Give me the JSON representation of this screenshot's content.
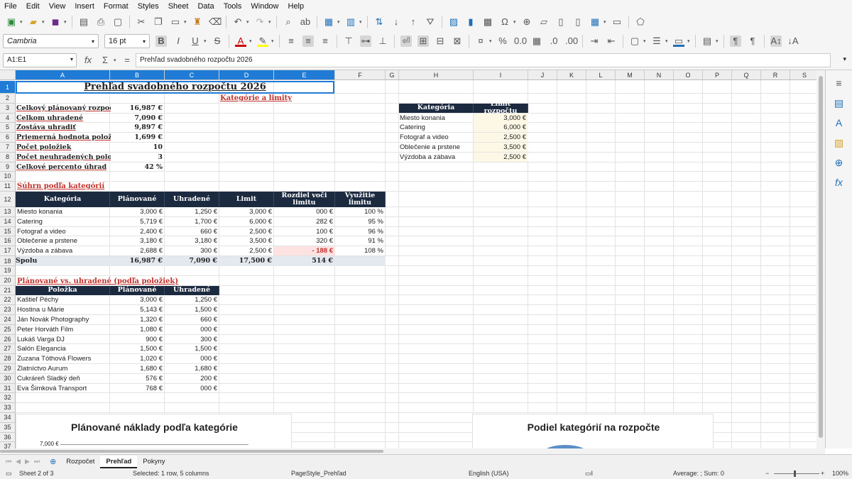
{
  "menu": [
    "File",
    "Edit",
    "View",
    "Insert",
    "Format",
    "Styles",
    "Sheet",
    "Data",
    "Tools",
    "Window",
    "Help"
  ],
  "font": {
    "name": "Cambria",
    "size": "16 pt"
  },
  "namebox": "A1:E1",
  "formula": "Prehľad svadobného rozpočtu 2026",
  "columns": [
    "A",
    "B",
    "C",
    "D",
    "E",
    "F",
    "G",
    "H",
    "I",
    "J",
    "K",
    "L",
    "M",
    "N",
    "O",
    "P",
    "Q",
    "R",
    "S"
  ],
  "rows": [
    "1",
    "2",
    "3",
    "4",
    "5",
    "6",
    "7",
    "8",
    "9",
    "10",
    "11",
    "12",
    "13",
    "14",
    "15",
    "16",
    "17",
    "18",
    "19",
    "20",
    "21",
    "22",
    "23",
    "24",
    "25",
    "26",
    "27",
    "28",
    "29",
    "30",
    "31",
    "32",
    "33",
    "34",
    "35",
    "36",
    "37"
  ],
  "title": "Prehľad svadobného rozpočtu 2026",
  "limits_heading": "Kategórie a limity",
  "summary": [
    {
      "label": "Celkový plánovaný rozpočet",
      "value": "16,987 €"
    },
    {
      "label": "Celkom uhradené",
      "value": "7,090 €"
    },
    {
      "label": "Zostáva uhradiť",
      "value": "9,897 €"
    },
    {
      "label": "Priemerná hodnota položky",
      "value": "1,699 €"
    },
    {
      "label": "Počet položiek",
      "value": "10"
    },
    {
      "label": "Počet neuhradených položie",
      "value": "3"
    },
    {
      "label": "Celkové percento úhrad",
      "value": "42 %"
    }
  ],
  "section_categories": "Súhrn podľa kategórií",
  "cat_headers": [
    "Kategória",
    "Plánované",
    "Uhradené",
    "Limit",
    "Rozdiel voči limitu",
    "Využitie limitu"
  ],
  "cat_rows": [
    [
      "Miesto konania",
      "3,000 €",
      "1,250 €",
      "3,000 €",
      "000 €",
      "100 %"
    ],
    [
      "Catering",
      "5,719 €",
      "1,700 €",
      "6,000 €",
      "282 €",
      "95 %"
    ],
    [
      "Fotograf a video",
      "2,400 €",
      "660 €",
      "2,500 €",
      "100 €",
      "96 %"
    ],
    [
      "Oblečenie a prstene",
      "3,180 €",
      "3,180 €",
      "3,500 €",
      "320 €",
      "91 %"
    ],
    [
      "Výzdoba a zábava",
      "2,688 €",
      "300 €",
      "2,500 €",
      "- 188 €",
      "108 %"
    ]
  ],
  "cat_total": [
    "Spolu",
    "16,987 €",
    "7,090 €",
    "17,500 €",
    "514 €",
    ""
  ],
  "section_items": "Plánované vs. uhradené (podľa položiek)",
  "item_headers": [
    "Položka",
    "Plánované",
    "Uhradené"
  ],
  "item_rows": [
    [
      "Kaštieľ Péchy",
      "3,000 €",
      "1,250 €"
    ],
    [
      "Hostina u Márie",
      "5,143 €",
      "1,500 €"
    ],
    [
      "Ján Novák Photography",
      "1,320 €",
      "660 €"
    ],
    [
      "Peter Horváth Film",
      "1,080 €",
      "000 €"
    ],
    [
      "Lukáš Varga DJ",
      "900 €",
      "300 €"
    ],
    [
      "Salón Elegancia",
      "1,500 €",
      "1,500 €"
    ],
    [
      "Zuzana Tóthová Flowers",
      "1,020 €",
      "000 €"
    ],
    [
      "Zlatníctvo Aurum",
      "1,680 €",
      "1,680 €"
    ],
    [
      "Cukráreň Sladký deň",
      "576 €",
      "200 €"
    ],
    [
      "Eva Šimková Transport",
      "768 €",
      "000 €"
    ]
  ],
  "limit_headers": [
    "Kategória",
    "Limit rozpočtu"
  ],
  "limit_rows": [
    [
      "Miesto konania",
      "3,000 €"
    ],
    [
      "Catering",
      "6,000 €"
    ],
    [
      "Fotograf a video",
      "2,500 €"
    ],
    [
      "Oblečenie a prstene",
      "3,500 €"
    ],
    [
      "Výzdoba a zábava",
      "2,500 €"
    ]
  ],
  "chart1_title": "Plánované náklady podľa kategórie",
  "chart1_tick": "7,000 €",
  "chart2_title": "Podiel kategórií na rozpočte",
  "tabs": [
    "Rozpočet",
    "Prehľad",
    "Pokyny"
  ],
  "status": {
    "sheet": "Sheet 2 of 3",
    "selection": "Selected: 1 row, 5 columns",
    "pagestyle": "PageStyle_Prehľad",
    "language": "English (USA)",
    "summary": "Average: ; Sum: 0",
    "zoom": "100%"
  },
  "colors": {
    "header_bg": "#1c2a3f",
    "accent_red": "#c0312b",
    "selection": "#1f7bd6",
    "negative_bg": "#fde2e2",
    "limit_bg": "#fdf8e6"
  }
}
